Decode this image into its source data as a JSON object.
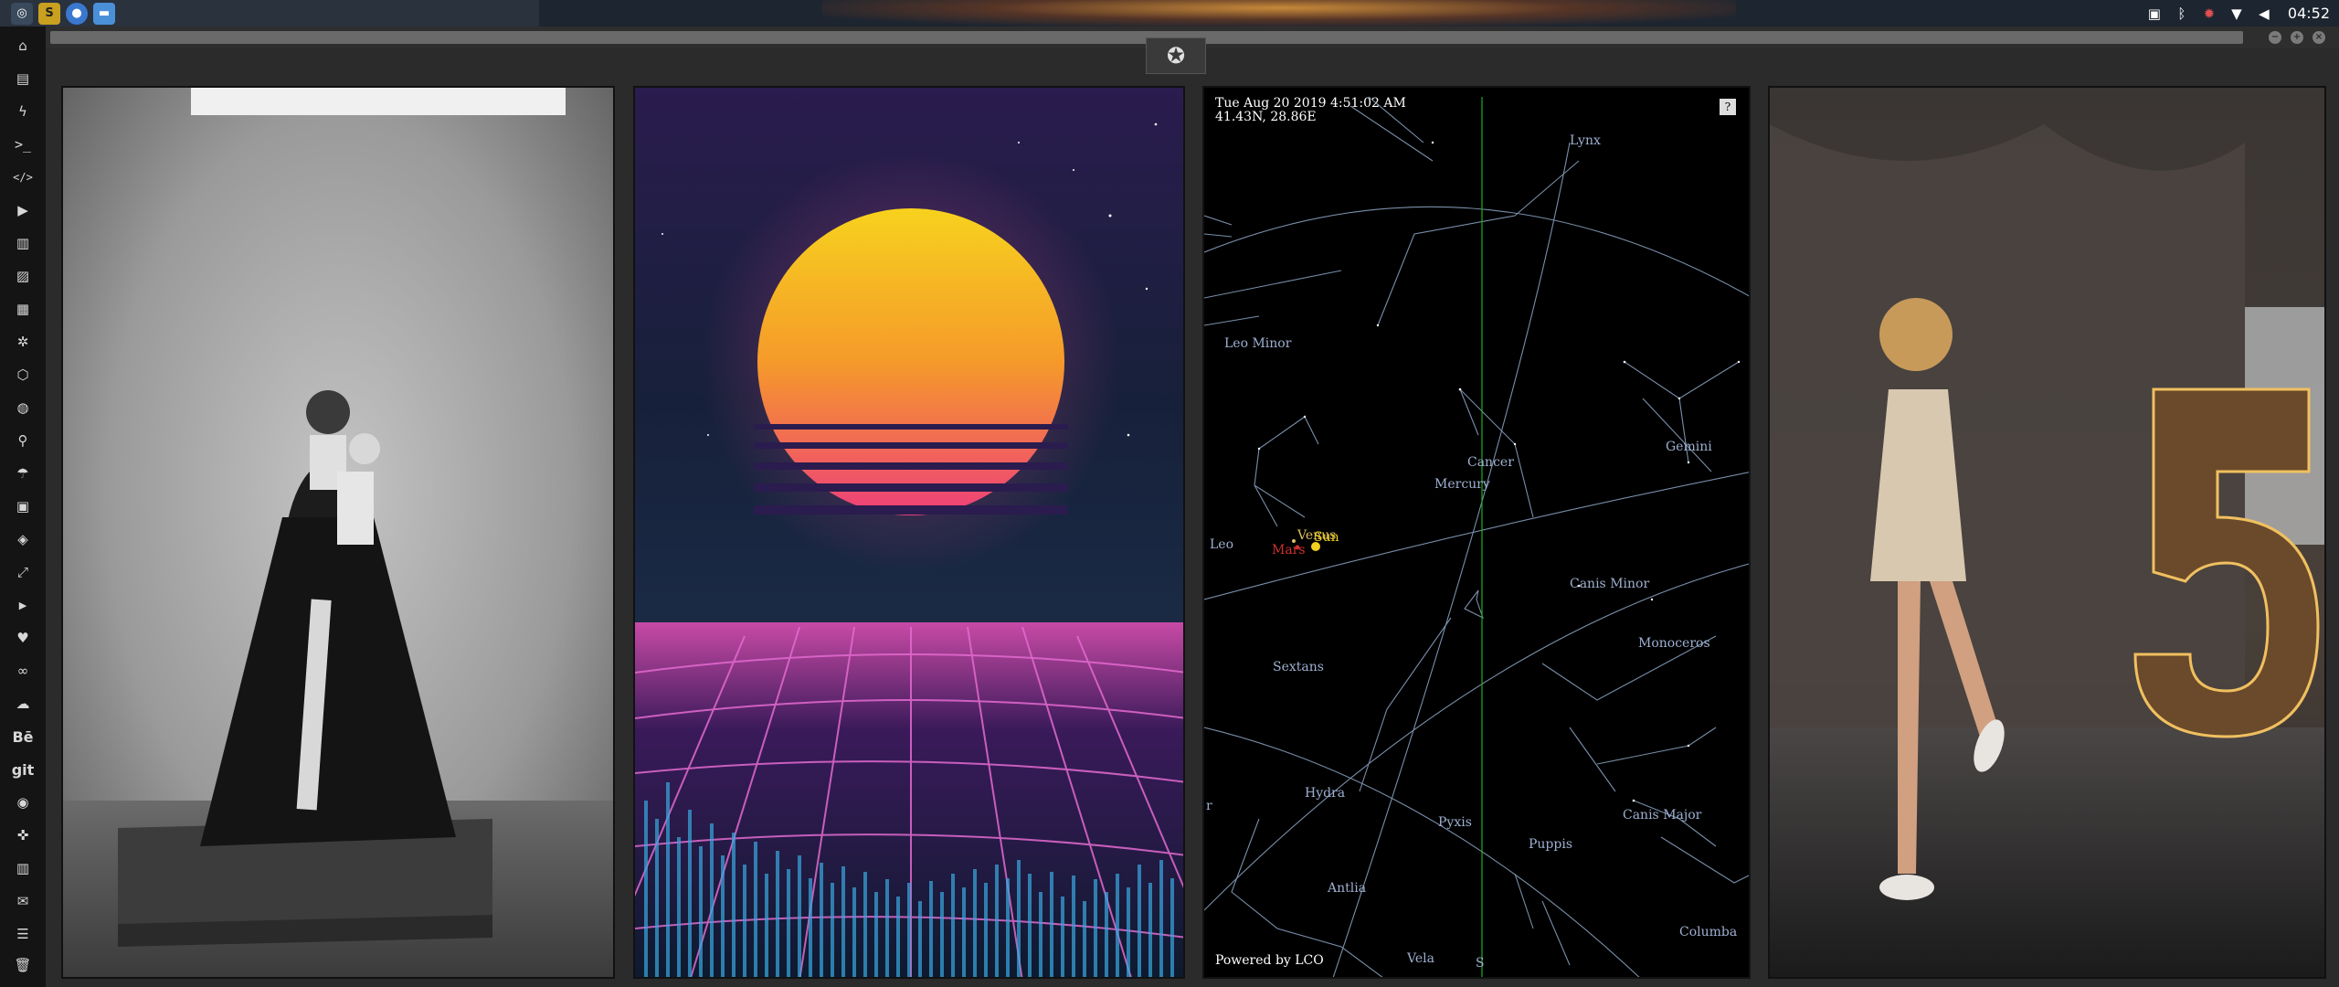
{
  "clock": "04:52",
  "tray_icons": [
    "image-icon",
    "bluetooth-icon",
    "settings-icon",
    "wifi-icon",
    "volume-icon"
  ],
  "launchers": [
    "menu-icon",
    "sublime-text-icon",
    "chromium-icon",
    "files-icon"
  ],
  "dock_icons": [
    "home-icon",
    "document-icon",
    "bolt-icon",
    "terminal-icon",
    "code-icon",
    "play-icon",
    "news-icon",
    "image-icon",
    "article-icon",
    "settings-icon",
    "hexagon-icon",
    "globe-icon",
    "search-icon",
    "umbrella-icon",
    "contact-icon",
    "tag-icon",
    "expand-icon",
    "youtube-icon",
    "heart-icon",
    "link-icon",
    "cloud-icon",
    "behance-icon",
    "git-icon",
    "github-icon",
    "gamepad-icon",
    "map-icon",
    "mail-icon",
    "server-icon",
    "trash-icon"
  ],
  "dock_text": {
    "behance": "Bē",
    "git": "git"
  },
  "window_controls": [
    "minimize",
    "maximize",
    "close"
  ],
  "sky": {
    "datetime": "Tue Aug 20 2019 4:51:02 AM",
    "coords": "41.43N, 28.86E",
    "help": "?",
    "footer": "Powered by LCO",
    "labels": {
      "lynx": "Lynx",
      "leo_minor": "Leo Minor",
      "gemini": "Gemini",
      "cancer": "Cancer",
      "mercury": "Mercury",
      "venus": "Venus",
      "sun": "Sun",
      "mars": "Mars",
      "leo": "Leo",
      "canis_minor": "Canis Minor",
      "monoceros": "Monoceros",
      "sextans": "Sextans",
      "hydra": "Hydra",
      "canis_major": "Canis Major",
      "pyxis": "Pyxis",
      "puppis": "Puppis",
      "antlia": "Antlia",
      "columba": "Columba",
      "vela": "Vela",
      "south": "S",
      "r": "r"
    }
  },
  "colors": {
    "planet_mars": "#d03030",
    "planet_sun": "#f0d020",
    "meridian": "#1fae1f",
    "constellation": "#9eb0d0"
  }
}
